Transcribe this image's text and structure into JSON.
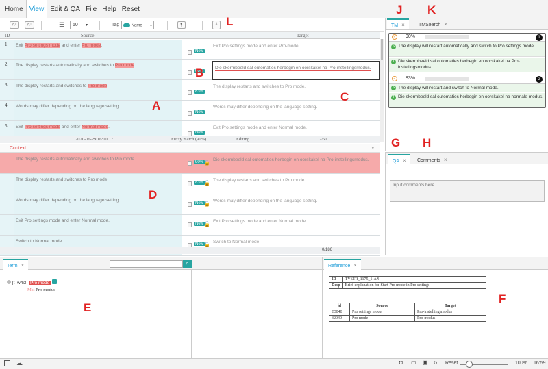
{
  "menu": {
    "items": [
      "Home",
      "View",
      "Edit & QA",
      "File",
      "Help",
      "Reset"
    ]
  },
  "toolbar": {
    "font_size": "50",
    "tag_label": "Tag",
    "tag_value": "Name",
    "pilcrow": "¶"
  },
  "grid": {
    "headers": {
      "id": "ID",
      "source": "Source",
      "target": "Target"
    },
    "rows": [
      {
        "id": "1",
        "src_parts": [
          "Exit ",
          "Pro settings mode",
          " and enter ",
          "Pro mode",
          "."
        ],
        "status": "New",
        "tgt": "Exit Pro settings mode and enter Pro-mode."
      },
      {
        "id": "2",
        "src_parts": [
          "The display restarts automatically and switches to ",
          "Pro mode",
          "."
        ],
        "status": "90%",
        "tgt": "Die skermbeeld sal outomaties herbegin en oorskakel na Pro-instellingsmodus."
      },
      {
        "id": "3",
        "src_parts": [
          "The display restarts and switches to ",
          "Pro mode",
          "."
        ],
        "status": "83%",
        "tgt": "The display restarts and switches to Pro mode."
      },
      {
        "id": "4",
        "src_parts": [
          "Words may differ depending on the language setting."
        ],
        "status": "New",
        "tgt": "Words may differ depending on the language setting."
      },
      {
        "id": "5",
        "src_parts": [
          "Exit ",
          "Pro settings mode",
          " and enter ",
          "Normal mode",
          "."
        ],
        "status": "New",
        "tgt": "Exit Pro settings mode and enter Normal mode."
      }
    ],
    "status": {
      "date": "2020-06-29 16:00:17",
      "match": "Fuzzy match (90%)",
      "state": "Editing",
      "count": "2/50"
    }
  },
  "context": {
    "title": "Context",
    "rows": [
      {
        "src": "The display restarts automatically and switches to Pro mode.",
        "status": "90%",
        "tgt": "Die skermbeeld sal outomaties herbegin en oorskakel na Pro-instellingsmodus."
      },
      {
        "src": "The display restarts and switches to Pro mode",
        "status": "83%",
        "tgt": "The display restarts and switches to Pro mode"
      },
      {
        "src": "Words may differ depending on the language setting.",
        "status": "New",
        "tgt": "Words may differ depending on the language setting."
      },
      {
        "src": "Exit Pro settings mode and enter Normal mode.",
        "status": "New",
        "tgt": "Exit Pro settings mode and enter Normal mode."
      },
      {
        "src": "Switch to Normal mode",
        "status": "New",
        "tgt": "Switch to Normal mode"
      }
    ],
    "count": "0/186"
  },
  "tm": {
    "tabs": [
      "TM",
      "TMSearch"
    ],
    "entries": [
      {
        "pct": "90%",
        "num": "1",
        "src": "The display will restart automatically and switch to Pro settings mode",
        "tgt": "Die skermbeeld sal outomaties herbegin en oorskakel na Pro-instellingsmodus."
      },
      {
        "pct": "83%",
        "num": "2",
        "src": "The display will restart and switch to Normal mode.",
        "tgt": "Die skermbeeld sal outomaties herbegin en oorskakel na normale modus."
      }
    ]
  },
  "qa": {
    "tabs": [
      "QA",
      "Comments"
    ],
    "placeholder": "Input comments here..."
  },
  "term": {
    "tab": "Term",
    "entry_id": "[t_w4i3]",
    "src_term": "Pro mode",
    "tgt_label": "Mat",
    "tgt_term": "Pro-modus"
  },
  "reference": {
    "tab": "Reference",
    "id_label": "ID",
    "id_value": "TVSTR_1175_1-AX",
    "desp_label": "Desp",
    "desp_value": "Brief explanation for Start Pro mode in Pro settings",
    "table_headers": [
      "id",
      "Source",
      "Target"
    ],
    "table_rows": [
      [
        "E3040",
        "Pro settings mode",
        "Pro-instellingsmodus"
      ],
      [
        "32040",
        "Pro mode",
        "Pro-modus"
      ]
    ]
  },
  "labels": {
    "A": "A",
    "B": "B",
    "C": "C",
    "D": "D",
    "E": "E",
    "F": "F",
    "G": "G",
    "H": "H",
    "J": "J",
    "K": "K",
    "L": "L"
  },
  "footer": {
    "reset": "Reset",
    "zoom": "100%",
    "time": "16:59"
  },
  "colors": {
    "accent": "#27a5a1",
    "highlight": "#f49a9a",
    "context_active": "#f6aaaa",
    "label_red": "#e12222"
  }
}
